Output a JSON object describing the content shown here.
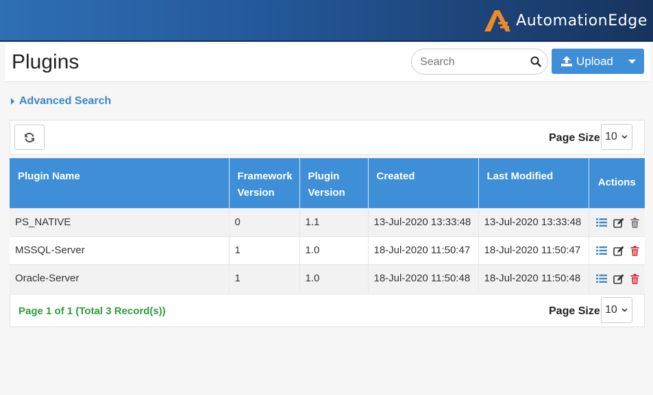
{
  "header": {
    "brand_text": "AutomationEdge",
    "colors": {
      "bar_start": "#2f6fb4",
      "bar_end": "#17345e",
      "logo_orange": "#f08a24"
    }
  },
  "page": {
    "title": "Plugins",
    "search_placeholder": "Search",
    "upload_label": "Upload",
    "advanced_search_label": "Advanced Search"
  },
  "toolbar": {
    "page_size_label": "Page Size",
    "page_size_value": "10"
  },
  "table": {
    "columns": [
      {
        "label": "Plugin Name"
      },
      {
        "label": "Framework Version"
      },
      {
        "label": "Plugin Version"
      },
      {
        "label": "Created"
      },
      {
        "label": "Last Modified"
      },
      {
        "label": "Actions"
      }
    ],
    "rows": [
      {
        "name": "PS_NATIVE",
        "framework": "0",
        "plugin": "1.1",
        "created": "13-Jul-2020 13:33:48",
        "modified": "13-Jul-2020 13:33:48",
        "delete_enabled": false
      },
      {
        "name": "MSSQL-Server",
        "framework": "1",
        "plugin": "1.0",
        "created": "18-Jul-2020 11:50:47",
        "modified": "18-Jul-2020 11:50:47",
        "delete_enabled": true
      },
      {
        "name": "Oracle-Server",
        "framework": "1",
        "plugin": "1.0",
        "created": "18-Jul-2020 11:50:48",
        "modified": "18-Jul-2020 11:50:48",
        "delete_enabled": true
      }
    ],
    "action_icons": [
      "list-icon",
      "edit-icon",
      "trash-icon"
    ],
    "colors": {
      "header_bg": "#3f8fd8",
      "icon_blue": "#3a86c8",
      "delete_red": "#d9363e",
      "delete_gray": "#777777"
    }
  },
  "footer": {
    "page_info": "Page 1 of 1 (Total 3 Record(s))",
    "page_size_label": "Page Size",
    "page_size_value": "10"
  }
}
